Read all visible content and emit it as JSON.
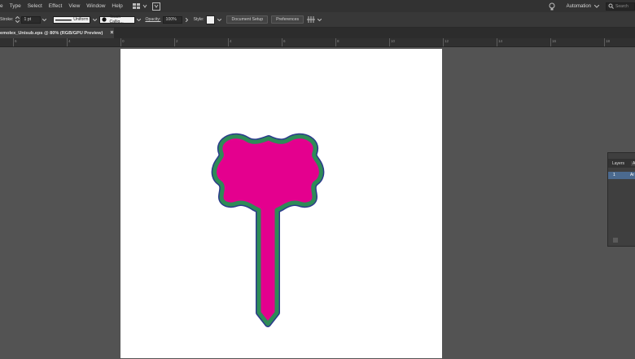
{
  "menu": {
    "items": [
      "e",
      "Type",
      "Select",
      "Effect",
      "View",
      "Window",
      "Help"
    ],
    "workspace": "Automation",
    "search_placeholder": "Search"
  },
  "control": {
    "stroke_label": "Stroke:",
    "stroke_value": "1 pt",
    "stroke_profile": "Uniform",
    "brush": "Touch Callig...",
    "opacity_label": "Opacity:",
    "opacity_value": "100%",
    "style_label": "Style:",
    "doc_setup": "Document Setup",
    "preferences": "Preferences"
  },
  "tab": {
    "title": "emolex_Unisub.eps @ 80% (RGB/GPU Preview)",
    "close": "×"
  },
  "ruler": {
    "labels": [
      "6",
      "4",
      "2",
      "0",
      "2",
      "4",
      "6",
      "8",
      "10",
      "12",
      "14",
      "16",
      "18"
    ]
  },
  "layers_panel": {
    "tab_layers": "Layers",
    "tab_artboards": "A",
    "row_index": "1",
    "row_name": "Ar"
  },
  "colors": {
    "fill": "#e4008e",
    "inner_stroke": "#2e8b57",
    "outer_stroke": "#2b3a8c"
  }
}
